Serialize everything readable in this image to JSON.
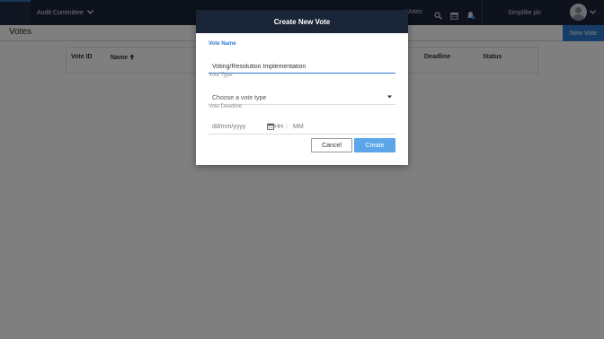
{
  "topbar": {
    "committee_label": "Audit Committee",
    "nav_votes_label": "Votes",
    "org_name": "Simplifie plc"
  },
  "page": {
    "title": "Votes",
    "new_vote_label": "New Vote"
  },
  "table": {
    "columns": [
      "Vote ID",
      "Name",
      "Deadline",
      "Status"
    ],
    "name_sort_arrow": "🡑"
  },
  "modal": {
    "title": "Create New Vote",
    "vote_name_label": "Vote Name",
    "vote_name_value": "Voting/Resolution Implementation",
    "vote_type_label": "Vote Type",
    "vote_type_placeholder": "Choose a vote type",
    "vote_deadline_label": "Vote Deadline",
    "date_placeholder": "dd/mm/yyyy",
    "hour_placeholder": "HH",
    "time_separator": ":",
    "minute_placeholder": "MM",
    "cancel_label": "Cancel",
    "create_label": "Create"
  },
  "colors": {
    "nav_bg": "#1b2538",
    "accent": "#2e7bcf",
    "create_button": "#5aa6e8",
    "overlay": "rgba(0,0,0,0.5)"
  },
  "icons": {
    "committee_dropdown": "chevron-down-icon",
    "search": "search-icon",
    "calendar": "calendar-icon",
    "notifications": "bell-icon",
    "avatar": "user-avatar-icon",
    "select_caret": "caret-down-icon",
    "date_picker": "calendar-icon"
  }
}
